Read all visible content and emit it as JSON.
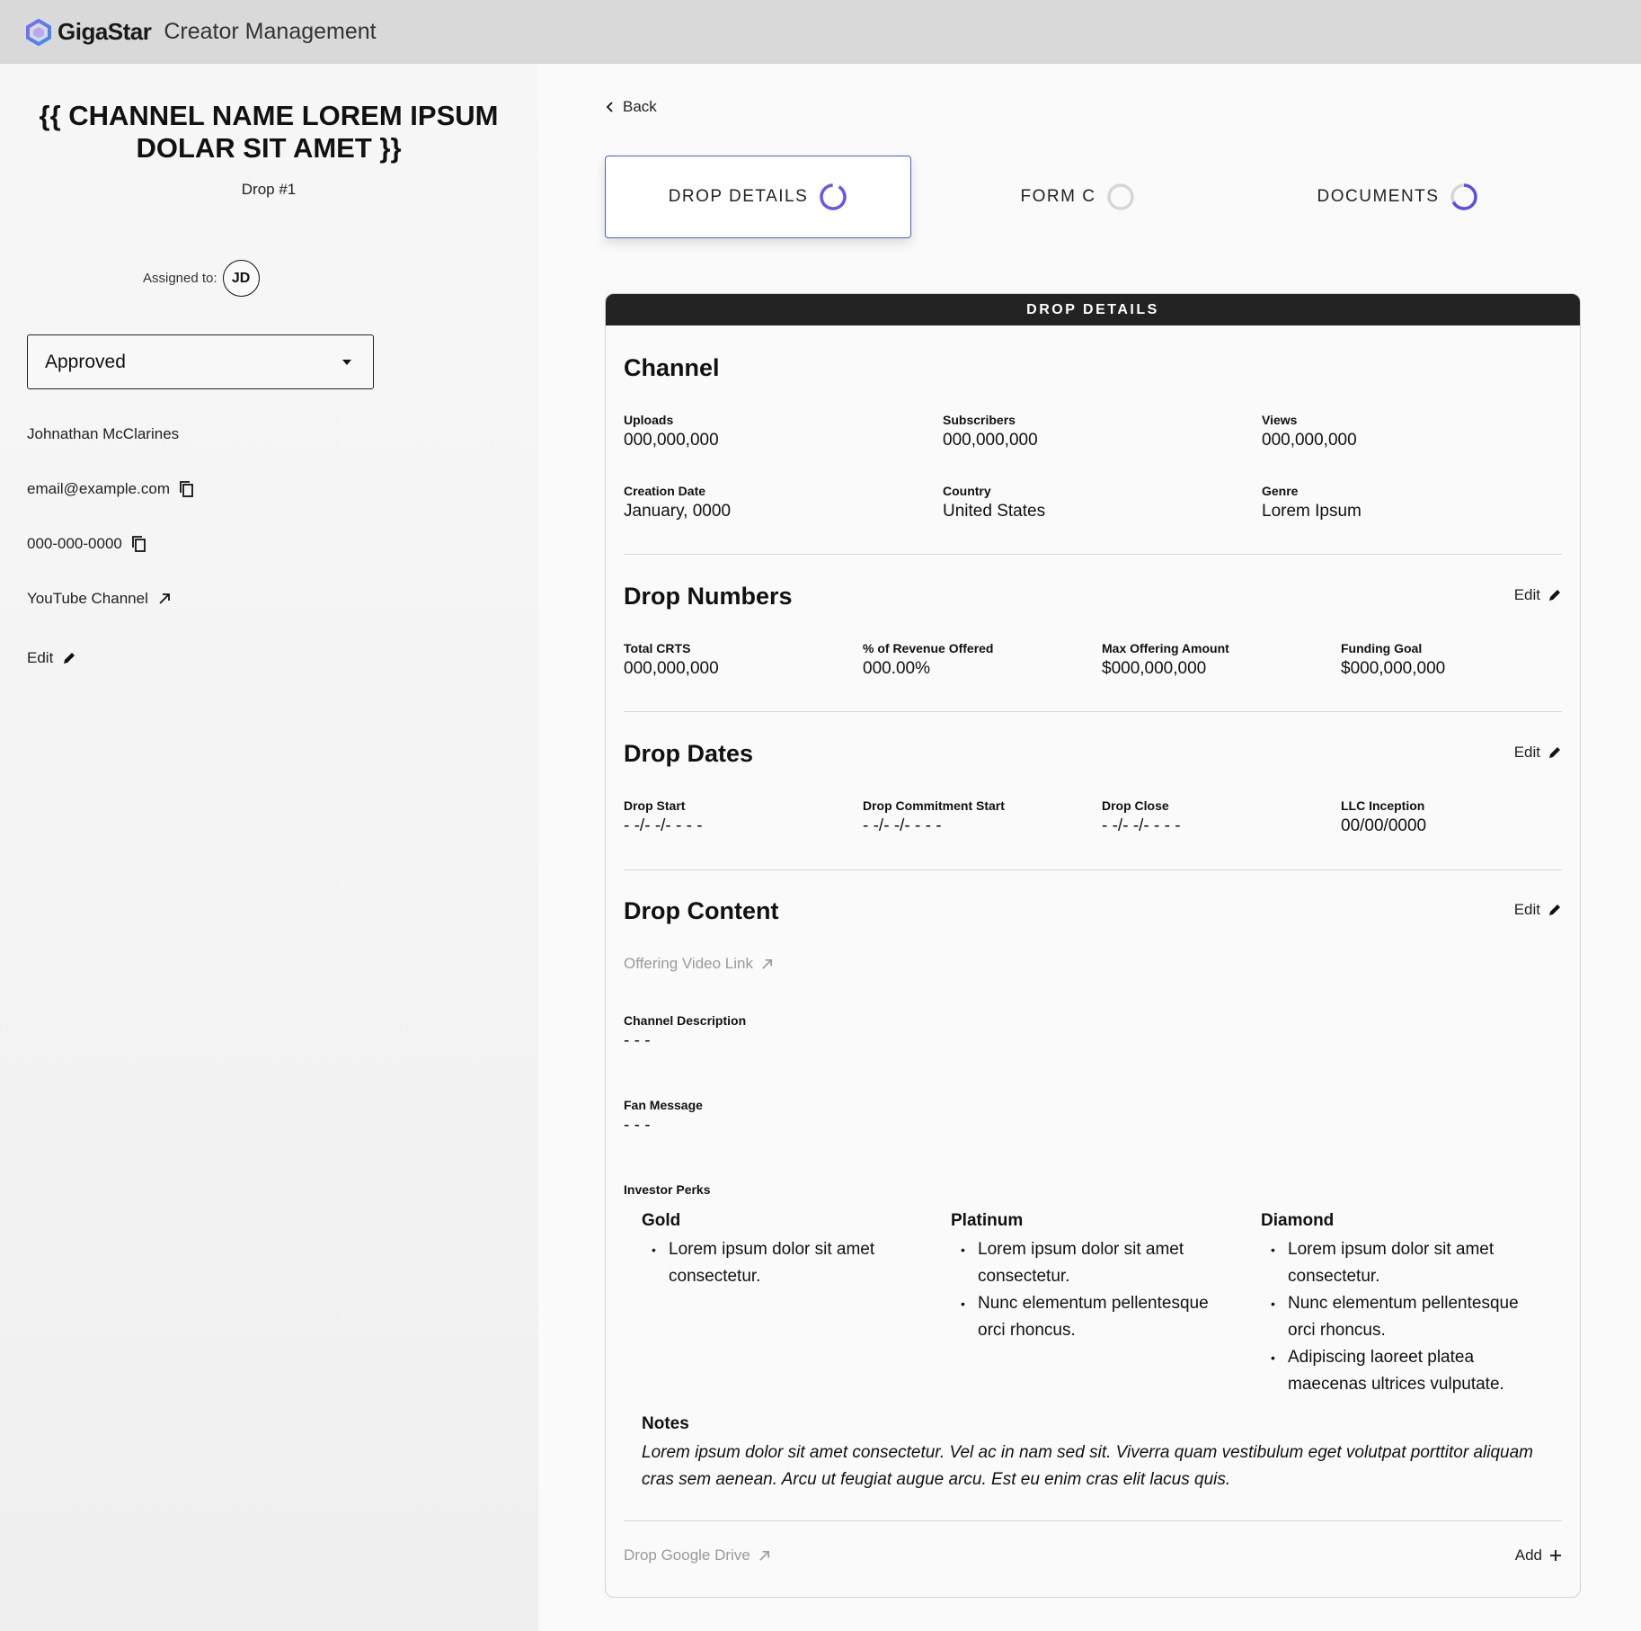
{
  "topbar": {
    "brand": "GigaStar",
    "app_name": "Creator Management"
  },
  "sidebar": {
    "channel_title": "{{ CHANNEL NAME LOREM IPSUM DOLAR SIT AMET }}",
    "drop_number": "Drop #1",
    "assigned_label": "Assigned to:",
    "assignee_initials": "JD",
    "status_value": "Approved",
    "creator_name": "Johnathan McClarines",
    "email": "email@example.com",
    "phone": "000-000-0000",
    "youtube_link": "YouTube Channel",
    "edit_label": "Edit"
  },
  "main": {
    "back_label": "Back",
    "tabs": [
      {
        "label": "DROP DETAILS"
      },
      {
        "label": "FORM C"
      },
      {
        "label": "DOCUMENTS"
      }
    ],
    "card_header": "DROP DETAILS",
    "channel": {
      "title": "Channel",
      "uploads_label": "Uploads",
      "uploads": "000,000,000",
      "subscribers_label": "Subscribers",
      "subscribers": "000,000,000",
      "views_label": "Views",
      "views": "000,000,000",
      "creation_label": "Creation Date",
      "creation": "January, 0000",
      "country_label": "Country",
      "country": "United States",
      "genre_label": "Genre",
      "genre": "Lorem Ipsum"
    },
    "numbers": {
      "title": "Drop Numbers",
      "edit": "Edit",
      "total_label": "Total CRTS",
      "total": "000,000,000",
      "revenue_label": "% of Revenue Offered",
      "revenue": "000.00%",
      "max_label": "Max Offering Amount",
      "max": "$000,000,000",
      "goal_label": "Funding Goal",
      "goal": "$000,000,000"
    },
    "dates": {
      "title": "Drop Dates",
      "edit": "Edit",
      "start_label": "Drop Start",
      "start": "- -/- -/- - - -",
      "commit_label": "Drop Commitment Start",
      "commit": "- -/- -/- - - -",
      "close_label": "Drop Close",
      "close": "- -/- -/- - - -",
      "llc_label": "LLC Inception",
      "llc": "00/00/0000"
    },
    "content": {
      "title": "Drop Content",
      "edit": "Edit",
      "video_link": "Offering Video Link",
      "desc_label": "Channel Description",
      "desc": "- - -",
      "fan_label": "Fan Message",
      "fan": "- - -",
      "perks_label": "Investor Perks",
      "perks": [
        {
          "name": "Gold",
          "items": [
            "Lorem ipsum dolor sit amet consectetur."
          ]
        },
        {
          "name": "Platinum",
          "items": [
            "Lorem ipsum dolor sit amet consectetur.",
            "Nunc elementum pellentesque orci rhoncus."
          ]
        },
        {
          "name": "Diamond",
          "items": [
            "Lorem ipsum dolor sit amet consectetur.",
            "Nunc elementum pellentesque orci rhoncus.",
            "Adipiscing laoreet platea maecenas ultrices vulputate."
          ]
        }
      ],
      "notes_title": "Notes",
      "notes_body": "Lorem ipsum dolor sit amet consectetur. Vel ac in nam sed sit. Viverra quam vestibulum eget volutpat porttitor aliquam cras sem aenean. Arcu ut feugiat augue arcu. Est eu enim cras elit lacus quis.",
      "drive_link": "Drop Google Drive",
      "add_label": "Add"
    }
  }
}
